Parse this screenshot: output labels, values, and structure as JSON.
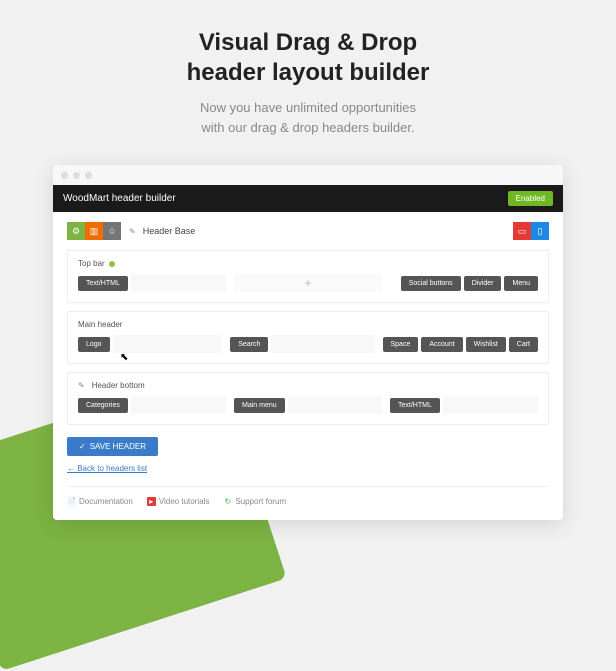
{
  "hero": {
    "title_line1": "Visual Drag & Drop",
    "title_line2": "header layout builder",
    "sub_line1": "Now you have unlimited opportunities",
    "sub_line2": "with our drag & drop headers builder."
  },
  "appbar": {
    "title": "WoodMart header builder",
    "status": "Enabled"
  },
  "toolbar": {
    "gear_icon": "gear",
    "layout_icon": "layout",
    "star_icon": "star",
    "pencil_icon": "pencil",
    "header_name": "Header Base",
    "desktop_icon": "desktop",
    "mobile_icon": "mobile"
  },
  "sections": {
    "topbar": {
      "title": "Top bar",
      "left": [
        "Text/HTML"
      ],
      "center_placeholder": "+",
      "right": [
        "Social buttons",
        "Divider",
        "Menu"
      ]
    },
    "main": {
      "title": "Main header",
      "left": [
        "Logo"
      ],
      "center": [
        "Search"
      ],
      "right": [
        "Space",
        "Account",
        "Wishlist",
        "Cart"
      ]
    },
    "bottom": {
      "title": "Header bottom",
      "left": [
        "Categories"
      ],
      "center": [
        "Main menu"
      ],
      "right": [
        "Text/HTML"
      ]
    }
  },
  "actions": {
    "save": "SAVE HEADER",
    "back": "← Back to headers list"
  },
  "footer": {
    "doc": "Documentation",
    "video": "Video tutorials",
    "support": "Support forum"
  }
}
